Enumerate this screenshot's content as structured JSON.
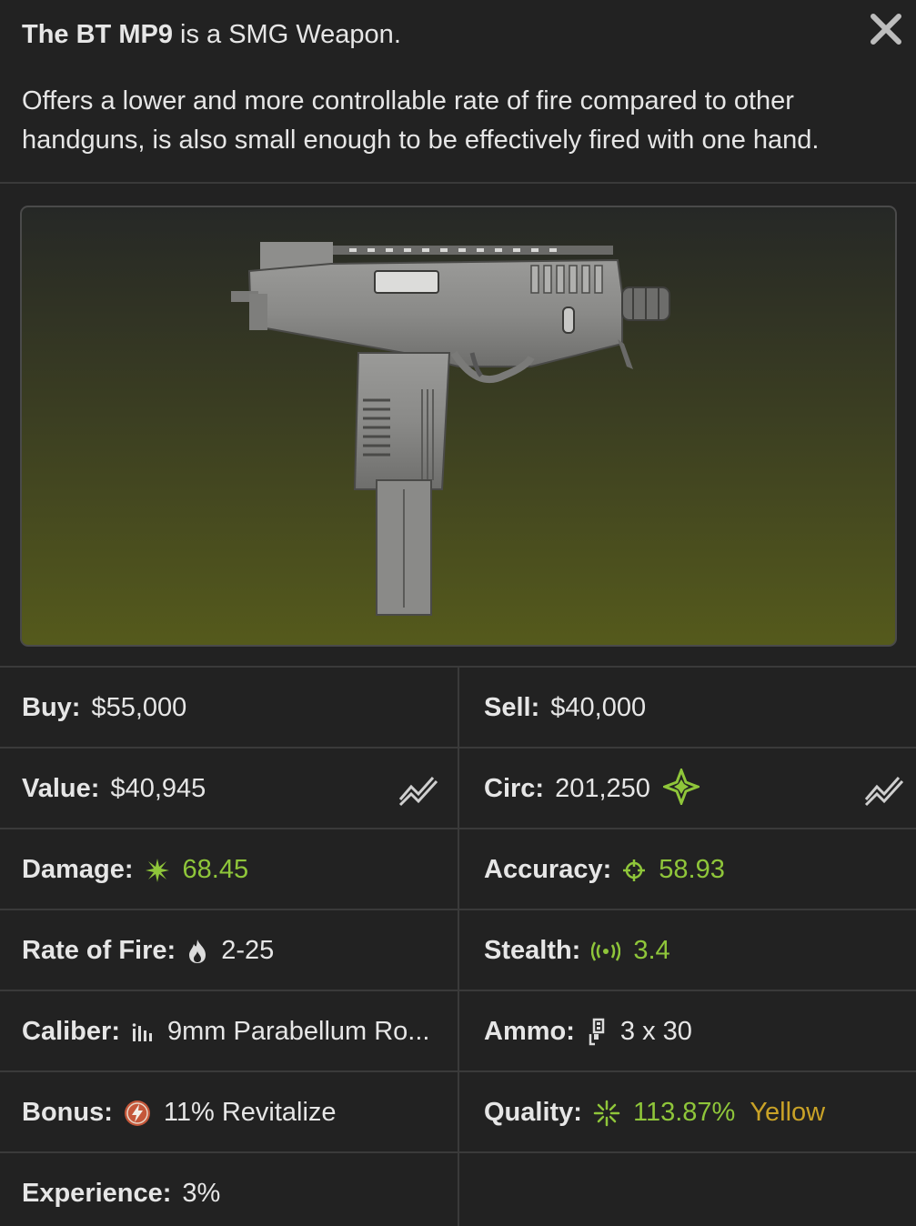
{
  "header": {
    "weapon_name": "The BT MP9",
    "title_rest": " is a SMG Weapon.",
    "description": "Offers a lower and more controllable rate of fire compared to other handguns, is also small enough to be effectively fired with one hand."
  },
  "icons": {
    "close": "close-icon",
    "trend": "trend-chart-icon",
    "circ": "four-point-star-icon",
    "damage": "burst-icon",
    "accuracy": "crosshair-icon",
    "rate_of_fire": "flame-icon",
    "stealth": "signal-icon",
    "caliber": "bullets-icon",
    "ammo": "magazine-icon",
    "bonus": "lightning-badge-icon",
    "quality": "sparkle-icon"
  },
  "colors": {
    "background": "#222222",
    "divider": "#3a3a3a",
    "green": "#8fc63a",
    "yellow": "#c9a227",
    "bonus_badge": "#c4573a"
  },
  "stats": {
    "buy": {
      "label": "Buy:",
      "value": "$55,000"
    },
    "sell": {
      "label": "Sell:",
      "value": "$40,000"
    },
    "value": {
      "label": "Value:",
      "value": "$40,945"
    },
    "circ": {
      "label": "Circ:",
      "value": "201,250"
    },
    "damage": {
      "label": "Damage:",
      "value": "68.45"
    },
    "accuracy": {
      "label": "Accuracy:",
      "value": "58.93"
    },
    "rate_of_fire": {
      "label": "Rate of Fire:",
      "value": "2-25"
    },
    "stealth": {
      "label": "Stealth:",
      "value": "3.4"
    },
    "caliber": {
      "label": "Caliber:",
      "value": "9mm Parabellum Ro..."
    },
    "ammo": {
      "label": "Ammo:",
      "value": "3 x 30"
    },
    "bonus": {
      "label": "Bonus:",
      "value": "11% Revitalize"
    },
    "quality": {
      "label": "Quality:",
      "value": "113.87%",
      "tier": "Yellow"
    },
    "experience": {
      "label": "Experience:",
      "value": "3%"
    }
  }
}
